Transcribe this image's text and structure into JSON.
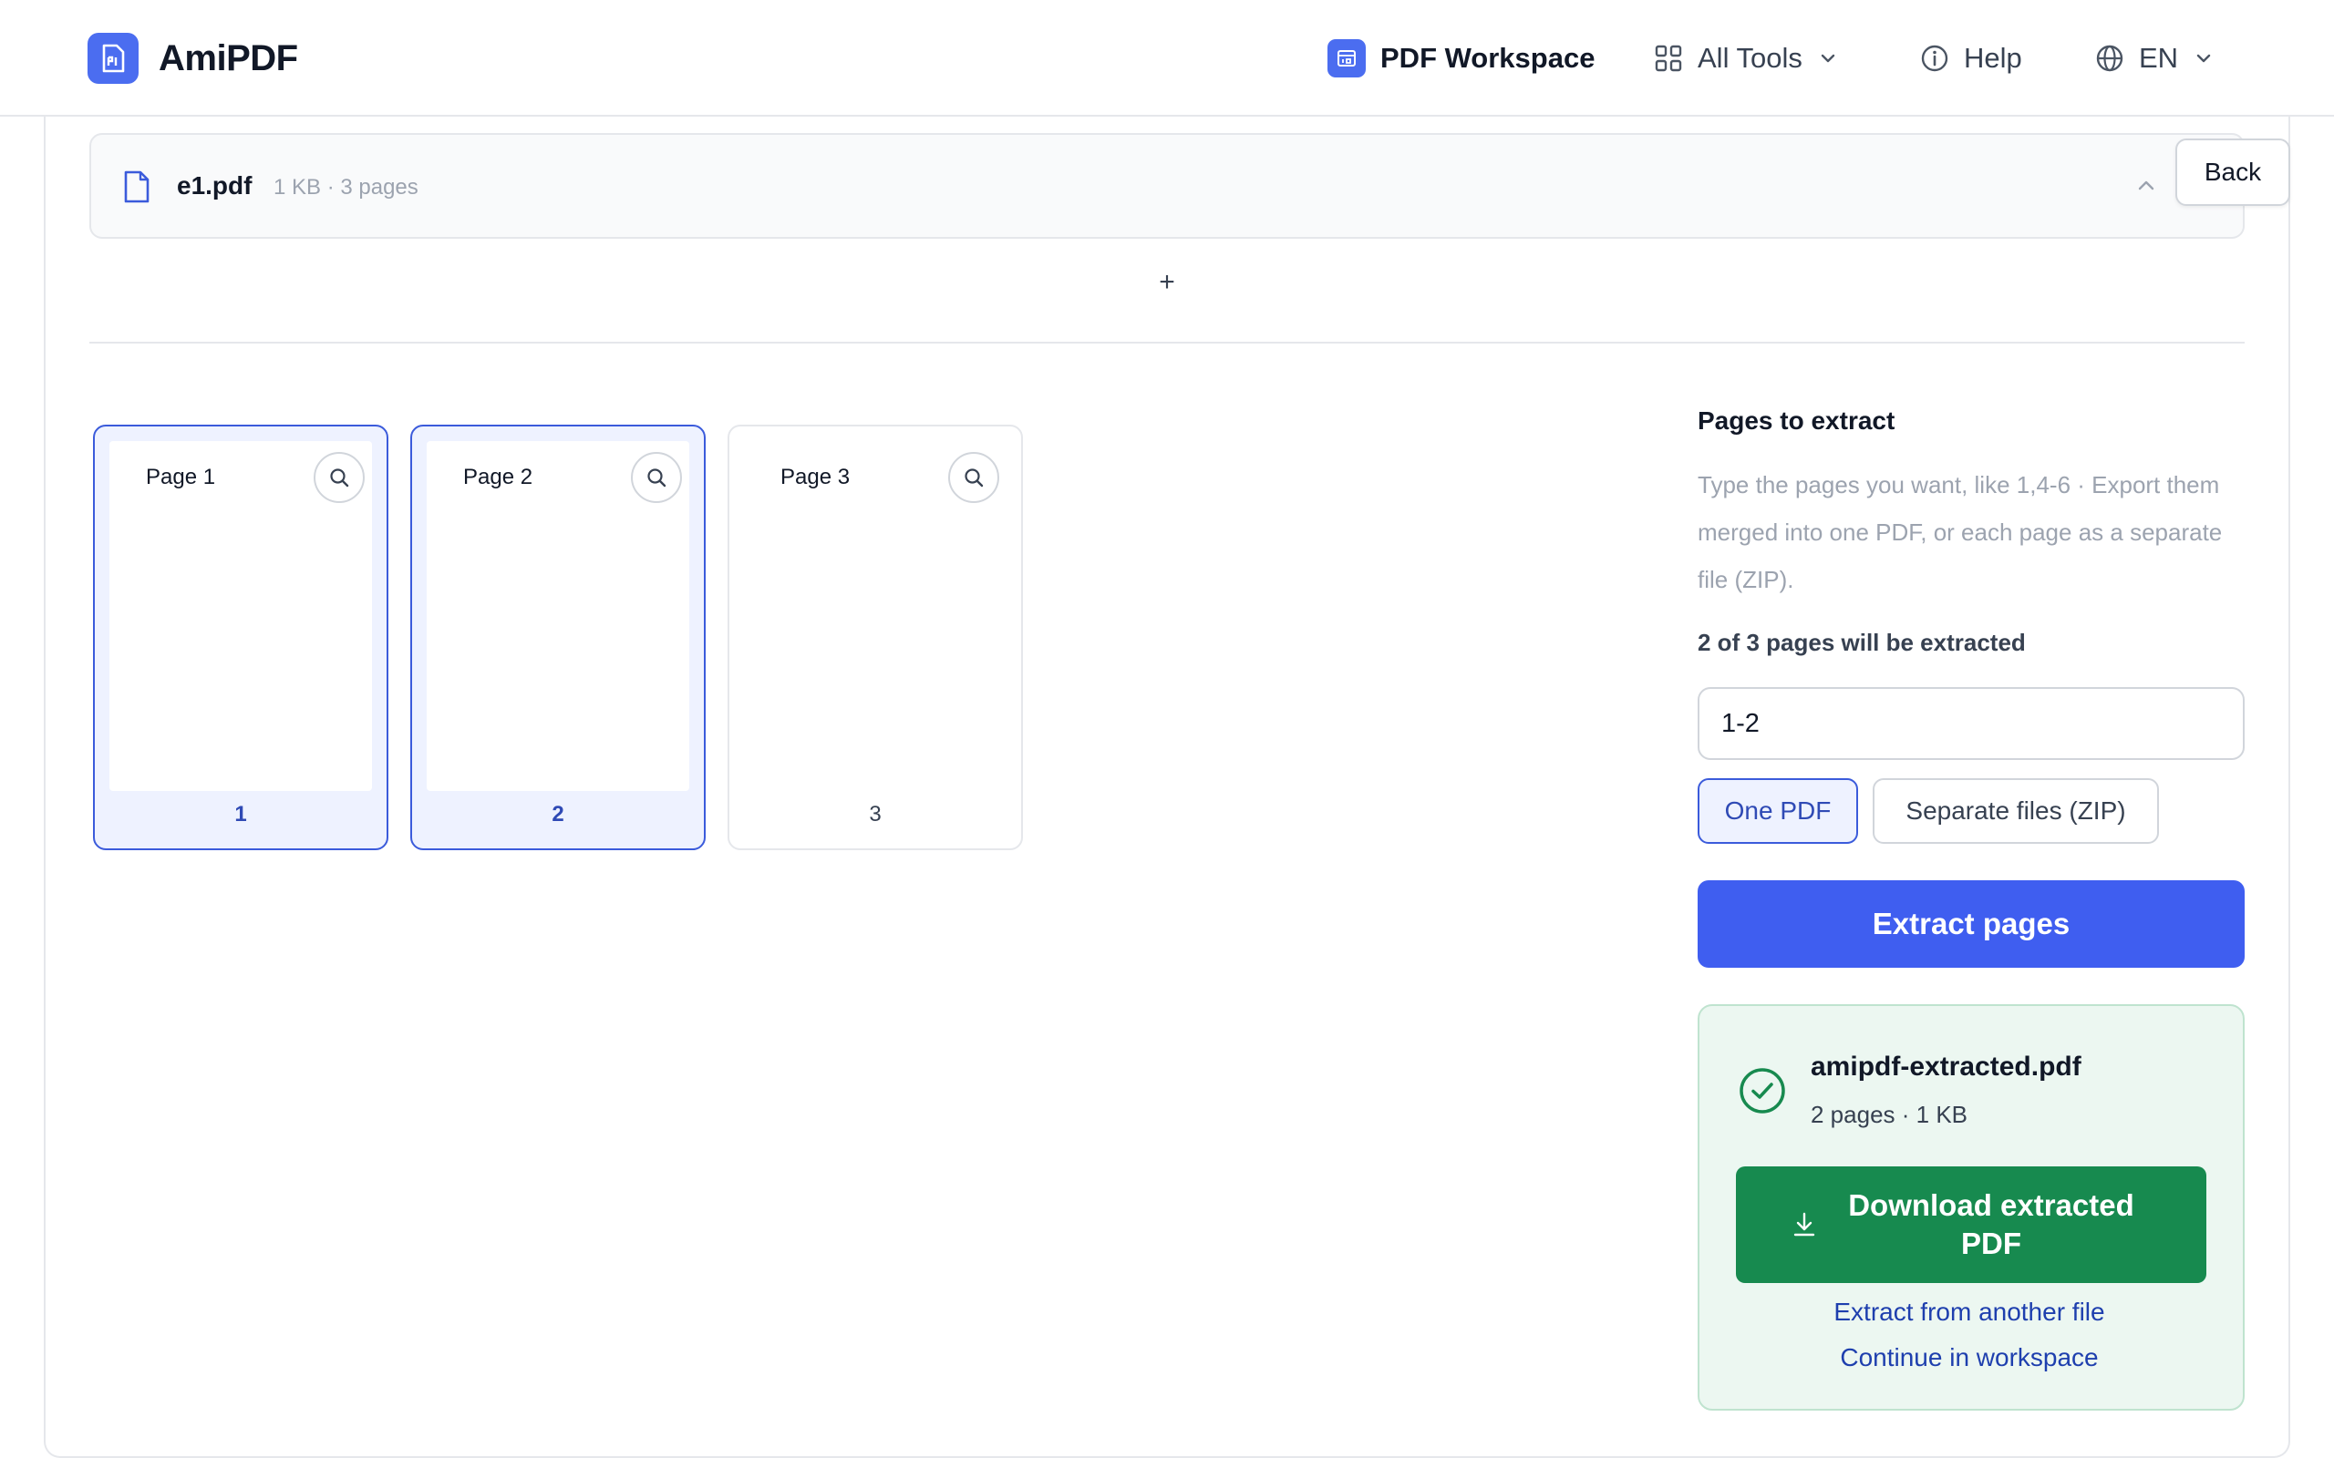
{
  "app": {
    "name": "AmiPDF",
    "accent_color": "#3f5ef0",
    "success_color": "#178a4f",
    "logo_icon": "pdf-logo-icon"
  },
  "nav": {
    "workspace_label": "PDF Workspace",
    "tools_label": "All Tools",
    "help_label": "Help",
    "lang_label": "EN"
  },
  "file": {
    "name": "e1.pdf",
    "meta": "1 KB · 3 pages"
  },
  "actions": {
    "back_label": "Back",
    "add_label": "+"
  },
  "pages": [
    {
      "title": "Page 1",
      "number": "1",
      "selected": true
    },
    {
      "title": "Page 2",
      "number": "2",
      "selected": true
    },
    {
      "title": "Page 3",
      "number": "3",
      "selected": false
    }
  ],
  "panel": {
    "title": "Pages to extract",
    "description": "Type the pages you want, like 1,4-6 · Export them merged into one PDF, or each page as a separate file (ZIP).",
    "count_text": "2 of 3 pages will be extracted",
    "range_value": "1-2",
    "mode_one_label": "One PDF",
    "mode_zip_label": "Separate files (ZIP)",
    "selected_mode": "One PDF",
    "extract_label": "Extract pages"
  },
  "result": {
    "file_name": "amipdf-extracted.pdf",
    "meta": "2 pages · 1 KB",
    "download_label": "Download extracted PDF",
    "link_another": "Extract from another file",
    "link_workspace": "Continue in workspace"
  }
}
